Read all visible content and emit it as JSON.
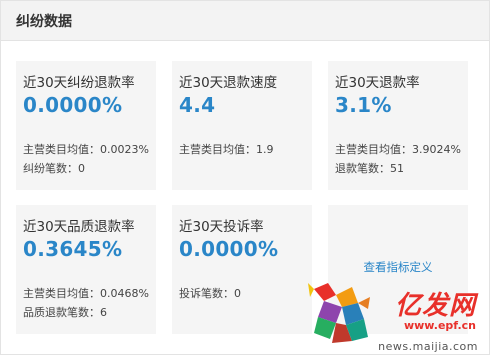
{
  "panel": {
    "title": "纠纷数据"
  },
  "cards": [
    {
      "title": "近30天纠纷退款率",
      "value": "0.0000%",
      "line1": "主营类目均值：0.0023%",
      "line2": "纠纷笔数：0"
    },
    {
      "title": "近30天退款速度",
      "value": "4.4",
      "line1": "主营类目均值：1.9",
      "line2": ""
    },
    {
      "title": "近30天退款率",
      "value": "3.1%",
      "line1": "主营类目均值：3.9024%",
      "line2": "退款笔数：51"
    },
    {
      "title": "近30天品质退款率",
      "value": "0.3645%",
      "line1": "主营类目均值：0.0468%",
      "line2": "品质退款笔数：6"
    },
    {
      "title": "近30天投诉率",
      "value": "0.0000%",
      "line1": "投诉笔数：0",
      "line2": ""
    }
  ],
  "link": {
    "label": "查看指标定义"
  },
  "watermark": {
    "brand": "亿发网",
    "site": "www.epf.cn",
    "news": "news.maijia.com"
  },
  "colors": {
    "accent": "#2a86c8",
    "card_bg": "#f5f5f5",
    "header_bg": "#f3f3f3",
    "brand_red": "#e8302a"
  }
}
